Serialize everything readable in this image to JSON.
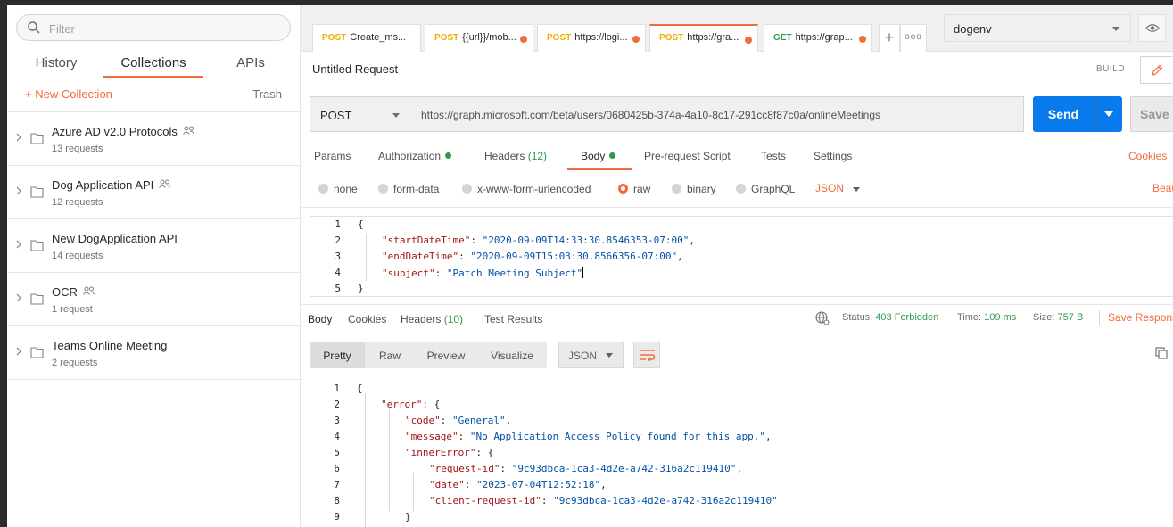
{
  "sidebar": {
    "filter_placeholder": "Filter",
    "tabs": [
      "History",
      "Collections",
      "APIs"
    ],
    "new_collection": "+  New Collection",
    "trash": "Trash",
    "collections": [
      {
        "name": "Azure AD v2.0 Protocols",
        "count": "13 requests",
        "shared": true
      },
      {
        "name": "Dog Application API",
        "count": "12 requests",
        "shared": true
      },
      {
        "name": "New DogApplication API",
        "count": "14 requests",
        "shared": false
      },
      {
        "name": "OCR",
        "count": "1 request",
        "shared": true
      },
      {
        "name": "Teams Online Meeting",
        "count": "2 requests",
        "shared": false
      }
    ]
  },
  "tabs": [
    {
      "method": "POST",
      "label": "Create_ms..."
    },
    {
      "method": "POST",
      "label": "{{url}}/mob..."
    },
    {
      "method": "POST",
      "label": "https://logi..."
    },
    {
      "method": "POST",
      "label": "https://gra..."
    },
    {
      "method": "GET",
      "label": "https://grap..."
    }
  ],
  "tab_more": "ooo",
  "environment": "dogenv",
  "request": {
    "title": "Untitled Request",
    "build": "BUILD",
    "method": "POST",
    "url": "https://graph.microsoft.com/beta/users/0680425b-374a-4a10-8c17-291cc8f87c0a/onlineMeetings",
    "send": "Send",
    "save": "Save"
  },
  "req_tabs": {
    "params": "Params",
    "authorization": "Authorization",
    "headers": "Headers",
    "headers_count": "(12)",
    "body": "Body",
    "prerequest": "Pre-request Script",
    "tests": "Tests",
    "settings": "Settings",
    "cookies": "Cookies"
  },
  "body_options": {
    "none": "none",
    "form_data": "form-data",
    "urlencoded": "x-www-form-urlencoded",
    "raw": "raw",
    "binary": "binary",
    "graphql": "GraphQL",
    "json": "JSON",
    "beautify": "Beautify"
  },
  "request_body": {
    "line_numbers": [
      "1",
      "2",
      "3",
      "4",
      "5"
    ],
    "start_key": "\"startDateTime\"",
    "start_val": "\"2020-09-09T14:33:30.8546353-07:00\"",
    "end_key": "\"endDateTime\"",
    "end_val": "\"2020-09-09T15:03:30.8566356-07:00\"",
    "subject_key": "\"subject\"",
    "subject_val": "\"Patch Meeting Subject\""
  },
  "response": {
    "tabs": {
      "body": "Body",
      "cookies": "Cookies",
      "headers": "Headers",
      "headers_count": "(10)",
      "test_results": "Test Results"
    },
    "status_label": "Status:",
    "status": "403 Forbidden",
    "time_label": "Time:",
    "time": "109 ms",
    "size_label": "Size:",
    "size": "757 B",
    "save_response": "Save Response",
    "views": [
      "Pretty",
      "Raw",
      "Preview",
      "Visualize"
    ],
    "format": "JSON",
    "line_numbers": [
      "1",
      "2",
      "3",
      "4",
      "5",
      "6",
      "7",
      "8",
      "9"
    ],
    "error_key": "\"error\"",
    "code_key": "\"code\"",
    "code_val": "\"General\"",
    "message_key": "\"message\"",
    "message_val": "\"No Application Access Policy found for this app.\"",
    "inner_key": "\"innerError\"",
    "reqid_key": "\"request-id\"",
    "reqid_val": "\"9c93dbca-1ca3-4d2e-a742-316a2c119410\"",
    "date_key": "\"date\"",
    "date_val": "\"2023-07-04T12:52:18\"",
    "client_key": "\"client-request-id\"",
    "client_val": "\"9c93dbca-1ca3-4d2e-a742-316a2c119410\""
  },
  "colors": {
    "accent": "#f26b3a",
    "send": "#097bed",
    "success": "#2f9a4c",
    "post": "#f0ad00"
  }
}
